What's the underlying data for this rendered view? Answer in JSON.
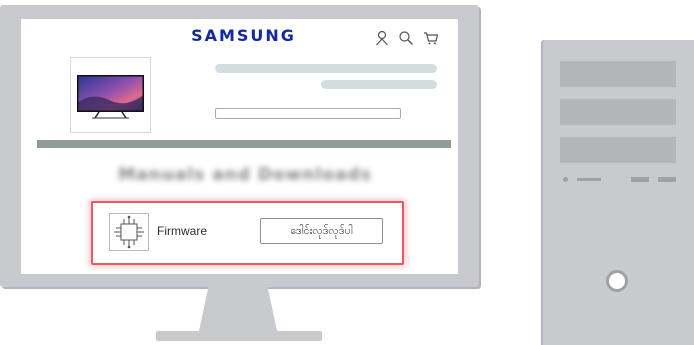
{
  "website": {
    "brand": "SAMSUNG",
    "header_icons": [
      "account-icon",
      "search-icon",
      "cart-icon"
    ],
    "blurred_heading": "Manuals and Downloads"
  },
  "firmware_panel": {
    "label": "Firmware",
    "download_button_label": "ဒေါင်းလုဒ်လုဒ်ပါ",
    "icon": "chip-icon",
    "highlight_color": "#e85a64"
  },
  "colors": {
    "brand_blue": "#1428a0",
    "device_gray": "#c9cacd",
    "skeleton": "#d3dde1"
  }
}
